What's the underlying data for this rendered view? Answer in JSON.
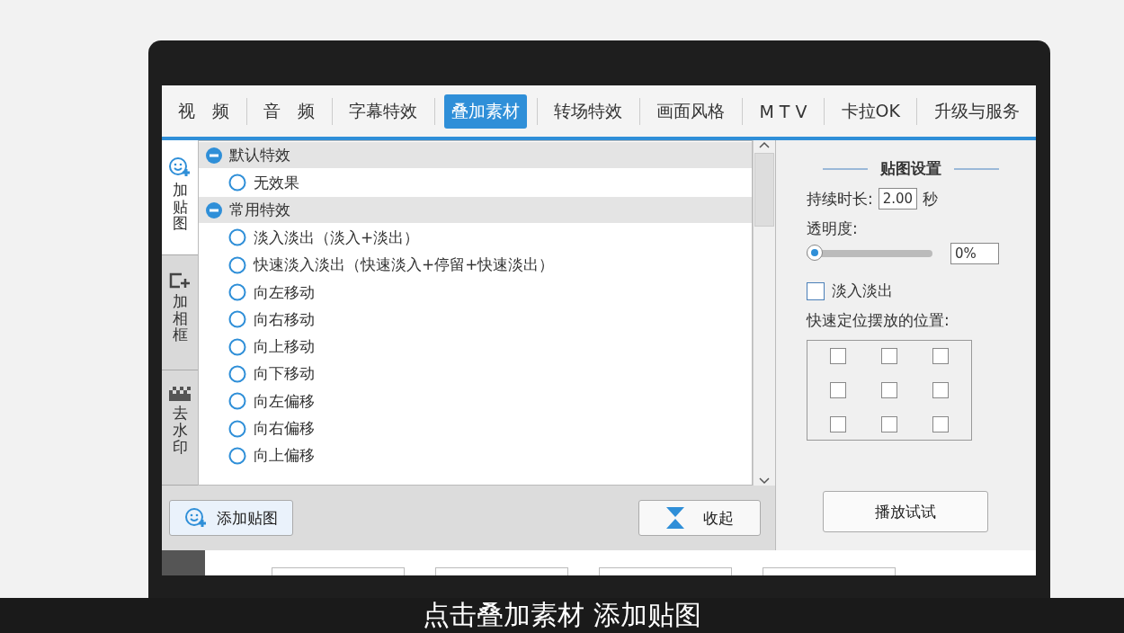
{
  "tabs": [
    {
      "label": "视　频",
      "selected": false
    },
    {
      "label": "音　频",
      "selected": false
    },
    {
      "label": "字幕特效",
      "selected": false
    },
    {
      "label": "叠加素材",
      "selected": true
    },
    {
      "label": "转场特效",
      "selected": false
    },
    {
      "label": "画面风格",
      "selected": false
    },
    {
      "label": "M T V",
      "selected": false
    },
    {
      "label": "卡拉OK",
      "selected": false
    },
    {
      "label": "升级与服务",
      "selected": false
    }
  ],
  "side_tabs": [
    {
      "kind": "sticker",
      "label": "加贴图",
      "selected": true
    },
    {
      "kind": "frame",
      "label": "加相框",
      "selected": false
    },
    {
      "kind": "watermark",
      "label": "去水印",
      "selected": false
    }
  ],
  "effect_groups": [
    {
      "label": "默认特效",
      "expanded": true,
      "items": [
        {
          "label": "无效果",
          "selected": false
        }
      ]
    },
    {
      "label": "常用特效",
      "expanded": true,
      "items": [
        {
          "label": "淡入淡出（淡入+淡出）",
          "selected": false
        },
        {
          "label": "快速淡入淡出（快速淡入+停留+快速淡出）",
          "selected": false
        },
        {
          "label": "向左移动",
          "selected": false
        },
        {
          "label": "向右移动",
          "selected": false
        },
        {
          "label": "向上移动",
          "selected": false
        },
        {
          "label": "向下移动",
          "selected": false
        },
        {
          "label": "向左偏移",
          "selected": false
        },
        {
          "label": "向右偏移",
          "selected": false
        },
        {
          "label": "向上偏移",
          "selected": false
        }
      ]
    }
  ],
  "add_button": "添加贴图",
  "collapse_button": "收起",
  "settings": {
    "title": "贴图设置",
    "duration_label": "持续时长:",
    "duration_value": "2.00",
    "duration_unit": "秒",
    "opacity_label": "透明度:",
    "opacity": {
      "level": 0
    },
    "opacity_value": "0%",
    "fade": {
      "label": "淡入淡出",
      "checked": false
    },
    "position_label": "快速定位摆放的位置:",
    "positions": [
      {
        "checked": false
      },
      {
        "checked": false
      },
      {
        "checked": false
      },
      {
        "checked": false
      },
      {
        "checked": false
      },
      {
        "checked": false
      },
      {
        "checked": false
      },
      {
        "checked": false
      },
      {
        "checked": false
      }
    ],
    "play_button": "播放试试"
  },
  "caption": "点击叠加素材 添加贴图"
}
